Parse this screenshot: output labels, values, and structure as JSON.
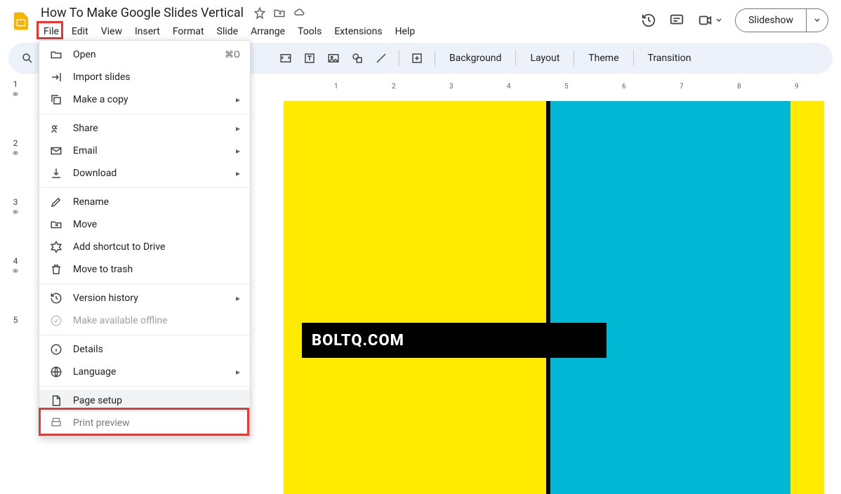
{
  "doc_title": "How To Make Google Slides Vertical",
  "menus": [
    "File",
    "Edit",
    "View",
    "Insert",
    "Format",
    "Slide",
    "Arrange",
    "Tools",
    "Extensions",
    "Help"
  ],
  "slideshow_label": "Slideshow",
  "toolbar_text": {
    "background": "Background",
    "layout": "Layout",
    "theme": "Theme",
    "transition": "Transition"
  },
  "thumbs": [
    "1",
    "2",
    "3",
    "4",
    "5"
  ],
  "ruler": [
    "1",
    "2",
    "3",
    "4",
    "5",
    "6",
    "7",
    "8",
    "9"
  ],
  "canvas_text": "BOLTQ.COM",
  "dropdown": {
    "open": {
      "label": "Open",
      "shortcut": "⌘O"
    },
    "import": "Import slides",
    "copy": "Make a copy",
    "share": "Share",
    "email": "Email",
    "download": "Download",
    "rename": "Rename",
    "move": "Move",
    "shortcut": "Add shortcut to Drive",
    "trash": "Move to trash",
    "version": "Version history",
    "offline": "Make available offline",
    "details": "Details",
    "language": "Language",
    "pagesetup": "Page setup",
    "print": "Print preview"
  }
}
